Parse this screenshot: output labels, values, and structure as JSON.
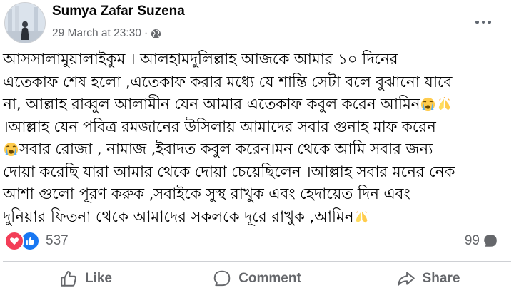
{
  "post": {
    "author": "Sumya Zafar Suzena",
    "timestamp": "29 March at 23:30",
    "separator": "·",
    "audience_icon": "globe-icon",
    "menu_icon": "more-horizontal-icon",
    "lines": [
      "আসসালামুয়ালাইকুম । আলহামদুলিল্লাহ আজকে আমার ১০ দিনের",
      "এতেকাফ শেষ হলো ,এতেকাফ করার মধ্যে যে শান্তি সেটা বলে বুঝানো যাবে",
      "না, আল্লাহ রাব্বুল আলামীন যেন আমার এতেকাফ কবুল করেন আমিন",
      "।আল্লাহ যেন পবিত্র রমজানের উসিলায় আমাদের সবার গুনাহ মাফ করেন",
      "সবার রোজা , নামাজ ,ইবাদত কবুল করেন।মন থেকে আমি সবার জন্য",
      "দোয়া করেছি যারা আমার থেকে দোয়া চেয়েছিলেন ।আল্লাহ সবার মনের নেক",
      "আশা গুলো পূরণ করুক ,সবাইকে সুস্থ রাখুক এবং হেদায়েত দিন এবং",
      "দুনিয়ার ফিতনা থেকে আমাদের সকলকে দূরে রাখুক ,আমিন"
    ],
    "emojis": {
      "crying": "loudly-crying-face-emoji",
      "praying": "folded-hands-emoji"
    }
  },
  "stats": {
    "reaction_icons": [
      "love-reaction-icon",
      "like-reaction-icon"
    ],
    "reaction_count": "537",
    "comment_count": "99",
    "comment_icon": "comment-bubble-icon"
  },
  "actions": {
    "like": "Like",
    "comment": "Comment",
    "share": "Share"
  },
  "colors": {
    "text": "#050505",
    "secondary": "#65676b",
    "love": "#f33e58",
    "like": "#1877f2",
    "divider": "#ced0d4"
  }
}
